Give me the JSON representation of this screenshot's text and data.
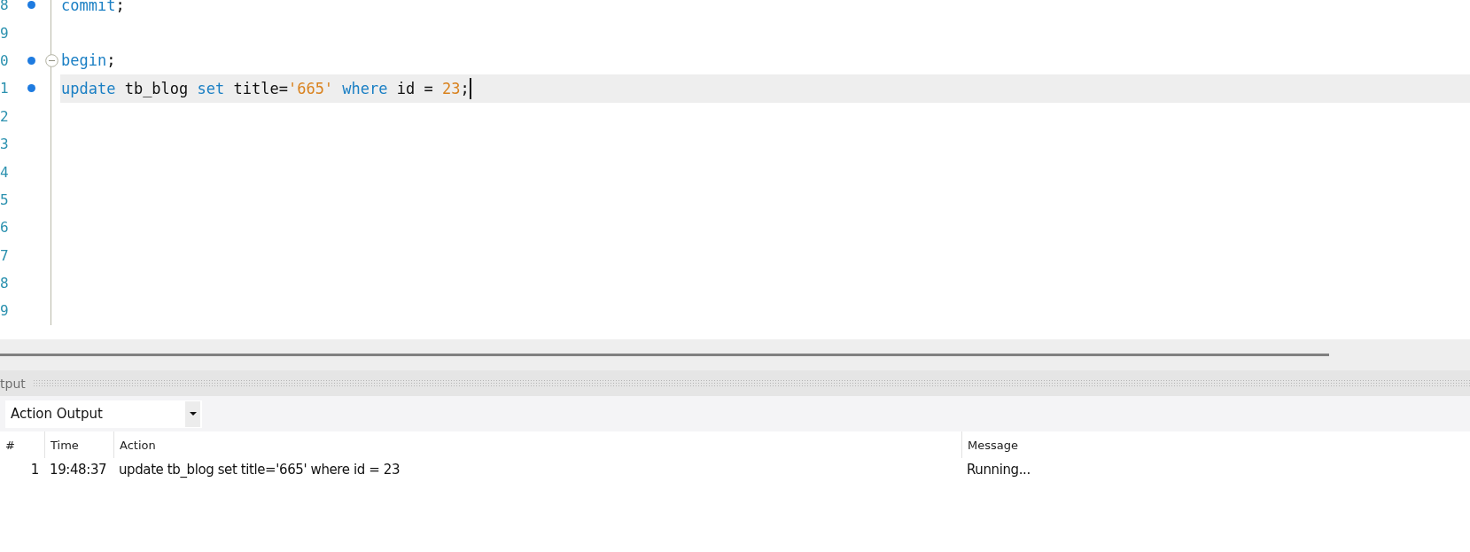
{
  "editor": {
    "lines": [
      {
        "number": "8",
        "modified": true,
        "fold": false,
        "current": false,
        "tokens": [
          {
            "kind": "keyword",
            "text": "commit"
          },
          {
            "kind": "plain",
            "text": ";"
          }
        ]
      },
      {
        "number": "9",
        "modified": false,
        "fold": false,
        "current": false
      },
      {
        "number": "0",
        "modified": true,
        "fold": true,
        "current": false,
        "tokens": [
          {
            "kind": "keyword",
            "text": "begin"
          },
          {
            "kind": "plain",
            "text": ";"
          }
        ]
      },
      {
        "number": "1",
        "modified": true,
        "fold": false,
        "current": true,
        "tokens": [
          {
            "kind": "keyword",
            "text": "update"
          },
          {
            "kind": "plain",
            "text": " tb_blog "
          },
          {
            "kind": "keyword",
            "text": "set"
          },
          {
            "kind": "plain",
            "text": " title="
          },
          {
            "kind": "string",
            "text": "'665'"
          },
          {
            "kind": "keyword",
            "text": " where"
          },
          {
            "kind": "plain",
            "text": " id = "
          },
          {
            "kind": "number",
            "text": "23"
          },
          {
            "kind": "plain",
            "text": ";"
          }
        ]
      },
      {
        "number": "2",
        "modified": false,
        "fold": false,
        "current": false
      },
      {
        "number": "3",
        "modified": false,
        "fold": false,
        "current": false
      },
      {
        "number": "4",
        "modified": false,
        "fold": false,
        "current": false
      },
      {
        "number": "5",
        "modified": false,
        "fold": false,
        "current": false
      },
      {
        "number": "6",
        "modified": false,
        "fold": false,
        "current": false
      },
      {
        "number": "7",
        "modified": false,
        "fold": false,
        "current": false
      },
      {
        "number": "8",
        "modified": false,
        "fold": false,
        "current": false
      },
      {
        "number": "9",
        "modified": false,
        "fold": false,
        "current": false
      }
    ]
  },
  "output_panel": {
    "title": "tput",
    "dropdown": {
      "value": "Action Output"
    },
    "table": {
      "columns": [
        "#",
        "Time",
        "Action",
        "Message"
      ],
      "rows": [
        {
          "cells": [
            "1",
            "19:48:37",
            "update tb_blog set title='665' where id = 23",
            "Running..."
          ]
        }
      ]
    }
  }
}
